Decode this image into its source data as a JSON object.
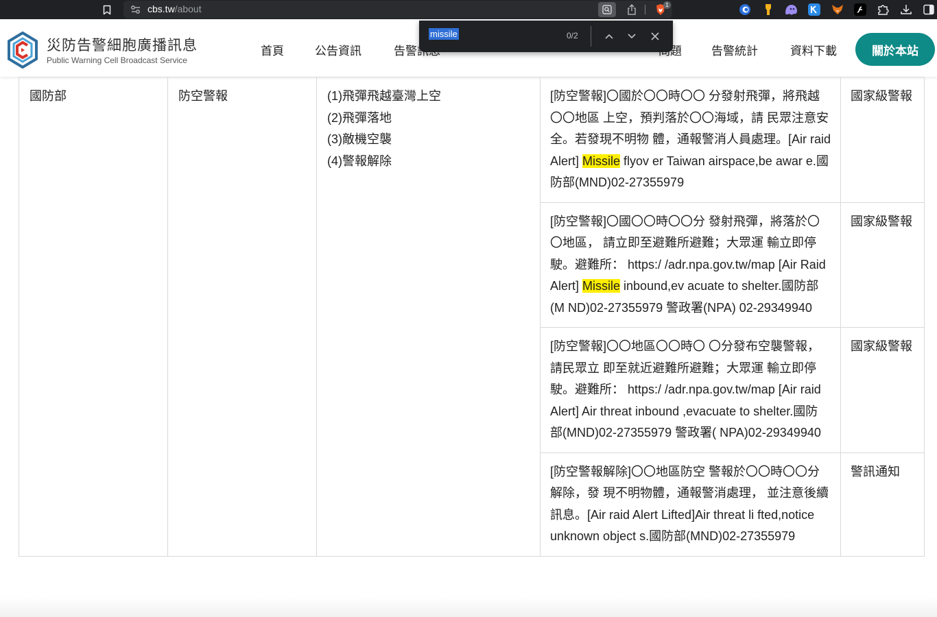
{
  "browser": {
    "url_host": "cbs.tw",
    "url_path": "/about",
    "brave_badge": "1",
    "extensions": [
      "edge-copilot-icon",
      "highlighter-icon",
      "ghost-icon",
      "k-app-icon",
      "fox-wallet-icon",
      "script-icon",
      "puzzle-icon",
      "download-icon",
      "sidebar-icon"
    ]
  },
  "find": {
    "query": "missile",
    "count": "0/2"
  },
  "site": {
    "title": "災防告警細胞廣播訊息",
    "subtitle": "Public Warning Cell Broadcast Service",
    "accent": "#0e8a87",
    "nav": [
      {
        "label": "首頁"
      },
      {
        "label": "公告資訊"
      },
      {
        "label": "告警訊息"
      },
      {
        "label": "問題"
      },
      {
        "label": "告警統計"
      },
      {
        "label": "資料下載"
      }
    ],
    "about_label": "關於本站"
  },
  "table": {
    "agency": "國防部",
    "category": "防空警報",
    "types": [
      "(1)飛彈飛越臺灣上空",
      "(2)飛彈落地",
      "(3)敵機空襲",
      "(4)警報解除"
    ],
    "rows": [
      {
        "before": "[防空警報]〇國於〇〇時〇〇 分發射飛彈，將飛越〇〇地區 上空，預判落於〇〇海域，請 民眾注意安全。若發現不明物 體，通報警消人員處理。[Air raid Alert] ",
        "match": "Missile",
        "after": " flyov er Taiwan airspace,be awar e.國防部(MND)02-27355979",
        "level": "國家級警報"
      },
      {
        "before": "[防空警報]〇國〇〇時〇〇分 發射飛彈，將落於〇〇地區， 請立即至避難所避難；大眾運 輸立即停駛。避難所： https:/ /adr.npa.gov.tw/map [Air Raid Alert] ",
        "match": "Missile",
        "after": " inbound,ev acuate to shelter.國防部(M ND)02-27355979 警政署(NPA) 02-29349940",
        "level": "國家級警報"
      },
      {
        "before": "[防空警報]〇〇地區〇〇時〇 〇分發布空襲警報，請民眾立 即至就近避難所避難；大眾運 輸立即停駛。避難所： https:/ /adr.npa.gov.tw/map [Air raid Alert] Air threat inbound ,evacuate to shelter.國防 部(MND)02-27355979 警政署( NPA)02-29349940",
        "match": "",
        "after": "",
        "level": "國家級警報"
      },
      {
        "before": "[防空警報解除]〇〇地區防空 警報於〇〇時〇〇分解除，發 現不明物體，通報警消處理， 並注意後續訊息。[Air raid Alert Lifted]Air threat li fted,notice unknown object s.國防部(MND)02-27355979",
        "match": "",
        "after": "",
        "level": "警訊通知"
      }
    ]
  }
}
